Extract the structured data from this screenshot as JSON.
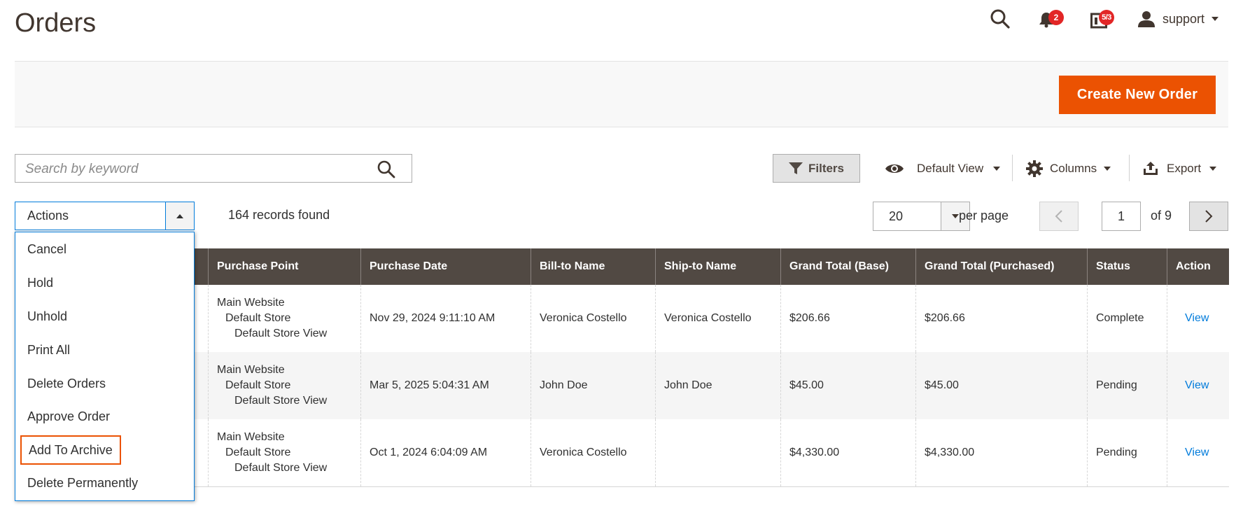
{
  "page": {
    "title": "Orders"
  },
  "header": {
    "notifications_count": "2",
    "system_messages_count": "5/3",
    "user_name": "support"
  },
  "page_actions": {
    "create_label": "Create New Order"
  },
  "search": {
    "placeholder": "Search by keyword",
    "value": ""
  },
  "toolbar": {
    "filters_label": "Filters",
    "view_label": "Default View",
    "columns_label": "Columns",
    "export_label": "Export"
  },
  "mass_actions": {
    "label": "Actions",
    "options": [
      "Cancel",
      "Hold",
      "Unhold",
      "Print All",
      "Delete Orders",
      "Approve Order",
      "Add To Archive",
      "Delete Permanently"
    ]
  },
  "records_found": "164 records found",
  "pager": {
    "per_page_value": "20",
    "per_page_label": "per page",
    "current_page": "1",
    "of_pages": "of 9"
  },
  "grid": {
    "columns": [
      "Purchase Point",
      "Purchase Date",
      "Bill-to Name",
      "Ship-to Name",
      "Grand Total (Base)",
      "Grand Total (Purchased)",
      "Status",
      "Action"
    ],
    "rows": [
      {
        "purchase_point": [
          "Main Website",
          "Default Store",
          "Default Store View"
        ],
        "purchase_date": "Nov 29, 2024 9:11:10 AM",
        "bill_to": "Veronica Costello",
        "ship_to": "Veronica Costello",
        "total_base": "$206.66",
        "total_purchased": "$206.66",
        "status": "Complete",
        "action": "View"
      },
      {
        "purchase_point": [
          "Main Website",
          "Default Store",
          "Default Store View"
        ],
        "purchase_date": "Mar 5, 2025 5:04:31 AM",
        "bill_to": "John Doe",
        "ship_to": "John Doe",
        "total_base": "$45.00",
        "total_purchased": "$45.00",
        "status": "Pending",
        "action": "View"
      },
      {
        "purchase_point": [
          "Main Website",
          "Default Store",
          "Default Store View"
        ],
        "purchase_date": "Oct 1, 2024 6:04:09 AM",
        "bill_to": "Veronica Costello",
        "ship_to": "",
        "total_base": "$4,330.00",
        "total_purchased": "$4,330.00",
        "status": "Pending",
        "action": "View"
      }
    ]
  },
  "icons": {
    "search": "search-icon",
    "notifications": "bell-icon",
    "system_messages": "system-messages-icon",
    "user": "user-icon",
    "filter": "filter-icon",
    "view": "eye-icon",
    "columns": "gear-icon",
    "export": "export-icon"
  },
  "colors": {
    "accent": "#eb5202",
    "table_header": "#514943",
    "link": "#007bdb",
    "badge": "#e22626",
    "focus_border": "#007bdb"
  }
}
